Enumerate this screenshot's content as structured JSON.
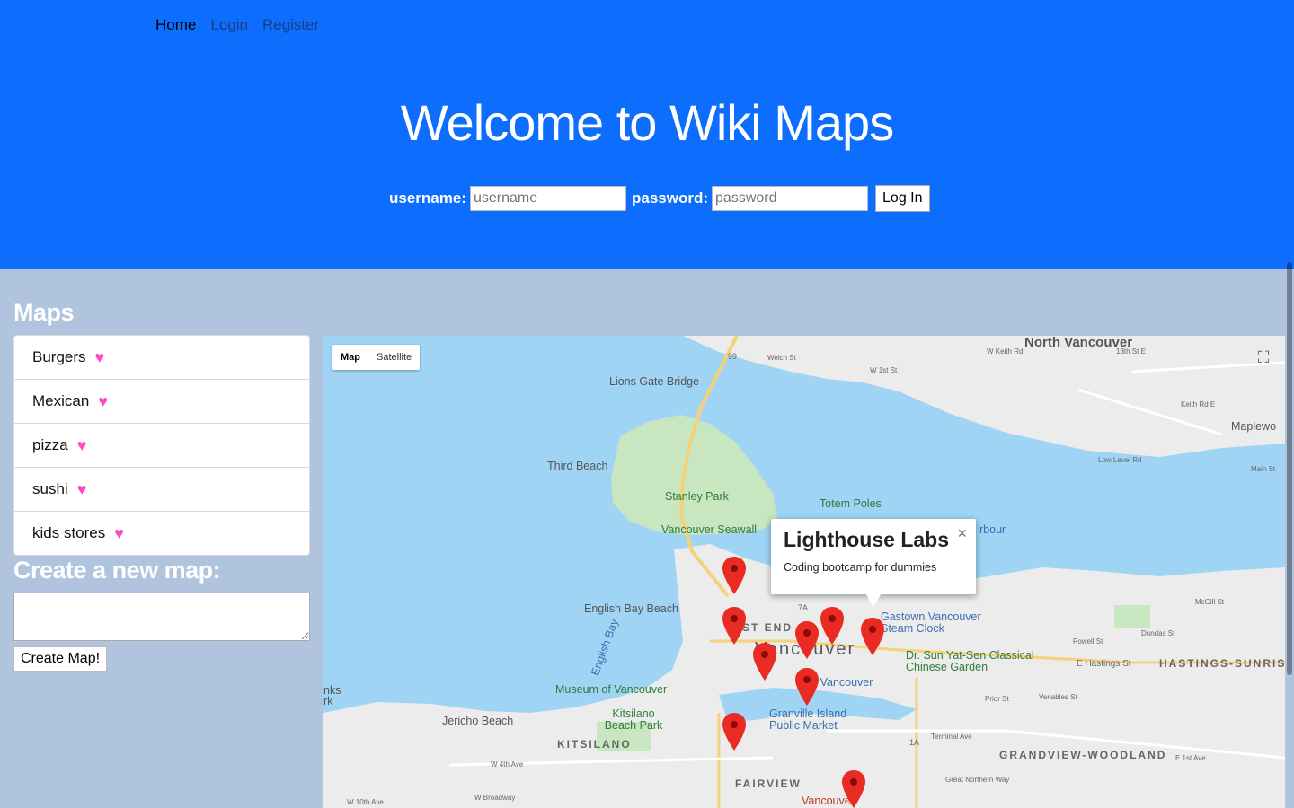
{
  "nav": {
    "home": "Home",
    "login": "Login",
    "register": "Register"
  },
  "hero": {
    "title": "Welcome to Wiki Maps",
    "username_label": "username:",
    "username_placeholder": "username",
    "password_label": "password:",
    "password_placeholder": "password",
    "login_button": "Log In"
  },
  "sidebar": {
    "maps_title": "Maps",
    "items": [
      {
        "label": "Burgers"
      },
      {
        "label": "Mexican"
      },
      {
        "label": "pizza"
      },
      {
        "label": "sushi"
      },
      {
        "label": "kids stores"
      }
    ],
    "heart_icon": "heart",
    "heart_color": "#ff47c8",
    "create_title": "Create a new map:",
    "create_value": "",
    "create_button": "Create Map!"
  },
  "map": {
    "type_map": "Map",
    "type_satellite": "Satellite",
    "fullscreen_icon": "fullscreen",
    "infowindow": {
      "title": "Lighthouse Labs",
      "description": "Coding bootcamp for dummies",
      "close": "×"
    },
    "labels": {
      "north_vancouver": "North Vancouver",
      "lions_gate": "Lions Gate Bridge",
      "third_beach": "Third Beach",
      "stanley_park": "Stanley Park",
      "totem_poles": "Totem Poles",
      "seawall": "Vancouver Seawall",
      "harbour": "rbour",
      "english_bay_beach": "English Bay Beach",
      "english_bay": "English Bay",
      "west_end": "ST END",
      "vancouver": "Vancouver",
      "gastown": "Gastown Vancouver Steam Clock",
      "sun_yat_sen": "Dr. Sun Yat-Sen Classical Chinese Garden",
      "hastings_sunrise": "HASTINGS-SUNRISE",
      "museum": "Museum of Vancouver",
      "jericho": "Jericho Beach",
      "kitsilano_beach": "Kitsilano Beach Park",
      "kitsilano": "KITSILANO",
      "granville": "Granville Island Public Market",
      "fairview": "FAIRVIEW",
      "grandview": "GRANDVIEW-WOODLAND",
      "maplewood": "Maplewo",
      "square": "rq Vancouver",
      "vancouve": "Vancouve",
      "e_hastings": "E Hastings St",
      "w_4th": "W 4th Ave",
      "w_broadway": "W Broadway",
      "w_10th": "W 10th Ave",
      "keith_rd": "Keith Rd E",
      "low_level": "Low Level Rd",
      "main_st": "Main St",
      "mcgill": "McGill St",
      "dundas": "Dundas St",
      "powell": "Powell St",
      "terminal": "Terminal Ave",
      "great_northern": "Great Northern Way",
      "e_1st": "E 1st Ave",
      "prior": "Prior St",
      "venables": "Venables St",
      "w_keith": "W Keith Rd",
      "w_1st": "W 1st St",
      "welch": "Welch St",
      "e_13th": "13th St E",
      "left_edge": "nks rk",
      "hw99": "99",
      "hw7a": "7A",
      "hw1a": "1A"
    },
    "pin_color": "#ea2b24"
  }
}
